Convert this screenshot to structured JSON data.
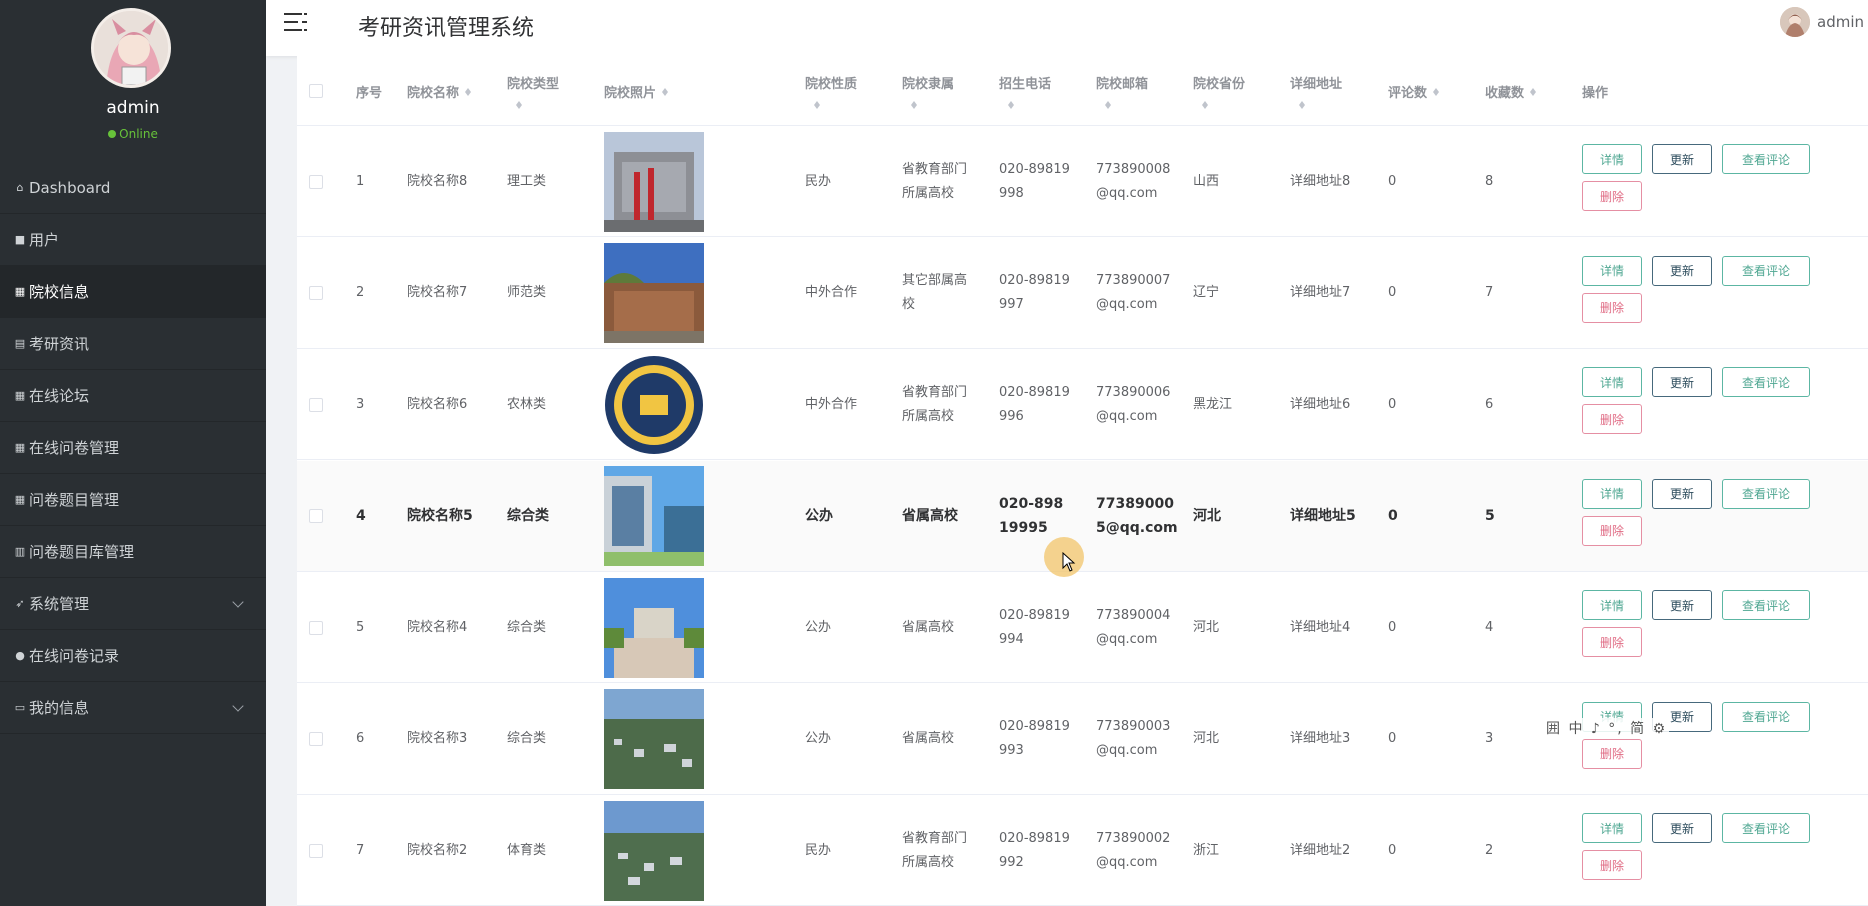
{
  "header": {
    "title": "考研资讯管理系统",
    "user": "admin"
  },
  "sidebar": {
    "username": "admin",
    "status": "Online",
    "items": [
      {
        "label": "Dashboard",
        "icon": "home-icon"
      },
      {
        "label": "用户",
        "icon": "square-icon"
      },
      {
        "label": "院校信息",
        "icon": "grid-icon",
        "active": true
      },
      {
        "label": "考研资讯",
        "icon": "doc-icon"
      },
      {
        "label": "在线论坛",
        "icon": "grid-icon"
      },
      {
        "label": "在线问卷管理",
        "icon": "grid-icon"
      },
      {
        "label": "问卷题目管理",
        "icon": "grid-icon"
      },
      {
        "label": "问卷题目库管理",
        "icon": "bar-icon"
      },
      {
        "label": "系统管理",
        "icon": "send-icon",
        "expandable": true
      },
      {
        "label": "在线问卷记录",
        "icon": "pin-icon"
      },
      {
        "label": "我的信息",
        "icon": "card-icon",
        "expandable": true
      }
    ]
  },
  "table": {
    "columns": [
      "序号",
      "院校名称",
      "院校类型",
      "院校照片",
      "院校性质",
      "院校隶属",
      "招生电话",
      "院校邮箱",
      "院校省份",
      "详细地址",
      "评论数",
      "收藏数",
      "操作"
    ],
    "actions": {
      "detail": "详情",
      "update": "更新",
      "comment": "查看评论",
      "delete": "删除"
    },
    "rows": [
      {
        "no": "1",
        "name": "院校名称8",
        "type": "理工类",
        "nature": "民办",
        "affil": "省教育部门所属高校",
        "phone": "020-89819998",
        "email": "773890008@qq.com",
        "province": "山西",
        "address": "详细地址8",
        "comments": "0",
        "favs": "8"
      },
      {
        "no": "2",
        "name": "院校名称7",
        "type": "师范类",
        "nature": "中外合作",
        "affil": "其它部属高校",
        "phone": "020-89819997",
        "email": "773890007@qq.com",
        "province": "辽宁",
        "address": "详细地址7",
        "comments": "0",
        "favs": "7"
      },
      {
        "no": "3",
        "name": "院校名称6",
        "type": "农林类",
        "nature": "中外合作",
        "affil": "省教育部门所属高校",
        "phone": "020-89819996",
        "email": "773890006@qq.com",
        "province": "黑龙江",
        "address": "详细地址6",
        "comments": "0",
        "favs": "6"
      },
      {
        "no": "4",
        "name": "院校名称5",
        "type": "综合类",
        "nature": "公办",
        "affil": "省属高校",
        "phone": "020-89819995",
        "email": "773890005@qq.com",
        "province": "河北",
        "address": "详细地址5",
        "comments": "0",
        "favs": "5"
      },
      {
        "no": "5",
        "name": "院校名称4",
        "type": "综合类",
        "nature": "公办",
        "affil": "省属高校",
        "phone": "020-89819994",
        "email": "773890004@qq.com",
        "province": "河北",
        "address": "详细地址4",
        "comments": "0",
        "favs": "4"
      },
      {
        "no": "6",
        "name": "院校名称3",
        "type": "综合类",
        "nature": "公办",
        "affil": "省属高校",
        "phone": "020-89819993",
        "email": "773890003@qq.com",
        "province": "河北",
        "address": "详细地址3",
        "comments": "0",
        "favs": "3"
      },
      {
        "no": "7",
        "name": "院校名称2",
        "type": "体育类",
        "nature": "民办",
        "affil": "省教育部门所属高校",
        "phone": "020-89819992",
        "email": "773890002@qq.com",
        "province": "浙江",
        "address": "详细地址2",
        "comments": "0",
        "favs": "2"
      }
    ]
  },
  "ime_bar": "囲 中 ♪ °, 简 ⚙"
}
